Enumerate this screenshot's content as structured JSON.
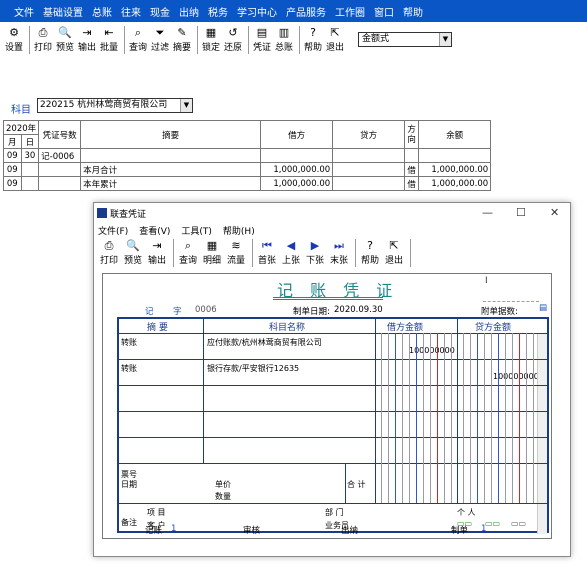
{
  "menu": [
    "文件",
    "基础设置",
    "总账",
    "往来",
    "现金",
    "出纳",
    "税务",
    "学习中心",
    "产品服务",
    "工作圈",
    "窗口",
    "帮助"
  ],
  "toolbar": [
    {
      "icon": "settings-icon",
      "label": "设置"
    },
    {
      "icon": "print-icon",
      "label": "打印"
    },
    {
      "icon": "preview-icon",
      "label": "预览"
    },
    {
      "icon": "export-icon",
      "label": "输出"
    },
    {
      "icon": "batch-icon",
      "label": "批量"
    },
    {
      "icon": "query-icon",
      "label": "查询"
    },
    {
      "icon": "filter-icon",
      "label": "过滤"
    },
    {
      "icon": "summary-icon",
      "label": "摘要"
    },
    {
      "icon": "lock-icon",
      "label": "锁定"
    },
    {
      "icon": "restore-icon",
      "label": "还原"
    },
    {
      "icon": "voucher-icon",
      "label": "凭证"
    },
    {
      "icon": "ledger-icon",
      "label": "总账"
    },
    {
      "icon": "help-icon",
      "label": "帮助"
    },
    {
      "icon": "exit-icon",
      "label": "退出"
    }
  ],
  "format_select": "金额式",
  "subject_label": "科目",
  "subject_value": "220215 杭州林莺商贸有限公司",
  "ledger": {
    "year_header": "2020年",
    "month_header": "月",
    "day_header": "日",
    "headers": [
      "凭证号数",
      "摘要",
      "借方",
      "贷方",
      "方向",
      "余额"
    ],
    "direction_header_top": "方",
    "direction_header_bottom": "向",
    "rows": [
      {
        "month": "09",
        "day": "30",
        "voucher": "记-0006",
        "summary": "",
        "debit": "",
        "credit": "",
        "dir": "",
        "balance": ""
      },
      {
        "month": "09",
        "day": "",
        "voucher": "",
        "summary": "本月合计",
        "debit": "1,000,000.00",
        "credit": "",
        "dir": "借",
        "balance": "1,000,000.00"
      },
      {
        "month": "09",
        "day": "",
        "voucher": "",
        "summary": "本年累计",
        "debit": "1,000,000.00",
        "credit": "",
        "dir": "借",
        "balance": "1,000,000.00"
      }
    ]
  },
  "dialog": {
    "title": "联查凭证",
    "menu": [
      "文件(F)",
      "查看(V)",
      "工具(T)",
      "帮助(H)"
    ],
    "toolbar": [
      {
        "icon": "print-icon",
        "label": "打印"
      },
      {
        "icon": "preview-icon",
        "label": "预览"
      },
      {
        "icon": "export-icon",
        "label": "输出"
      },
      {
        "icon": "query-icon",
        "label": "查询"
      },
      {
        "icon": "detail-icon",
        "label": "明细"
      },
      {
        "icon": "flow-icon",
        "label": "流量"
      },
      {
        "icon": "first-icon",
        "label": "首张"
      },
      {
        "icon": "prev-icon",
        "label": "上张"
      },
      {
        "icon": "next-icon",
        "label": "下张"
      },
      {
        "icon": "last-icon",
        "label": "末张"
      },
      {
        "icon": "help-icon",
        "label": "帮助"
      },
      {
        "icon": "exit-icon",
        "label": "退出"
      }
    ],
    "voucher": {
      "title": "记 账 凭 证",
      "type_label": "记",
      "no_label": "字",
      "no_value": "0006",
      "date_label": "制单日期:",
      "date_value": "2020.09.30",
      "attach_label": "附单据数:",
      "col_summary": "摘 要",
      "col_account": "科目名称",
      "col_debit": "借方金额",
      "col_credit": "贷方金额",
      "lines": [
        {
          "summary": "转账",
          "account": "应付账款/杭州林莺商贸有限公司",
          "debit": "100000000",
          "credit": ""
        },
        {
          "summary": "转账",
          "account": "银行存款/平安银行12635",
          "debit": "",
          "credit": "100000000"
        }
      ],
      "ticket_no": "票号",
      "date_field": "日期",
      "unit_price": "单价",
      "quantity": "数量",
      "total": "合 计",
      "remark": "备注",
      "project": "项  目",
      "department": "部  门",
      "individual": "个  人",
      "customer": "客  户",
      "salesman": "业务员",
      "footer": {
        "bookkeep": "记账",
        "bookkeep_v": "1",
        "review": "审核",
        "cashier": "出纳",
        "maker": "制单",
        "maker_v": "1"
      }
    }
  }
}
